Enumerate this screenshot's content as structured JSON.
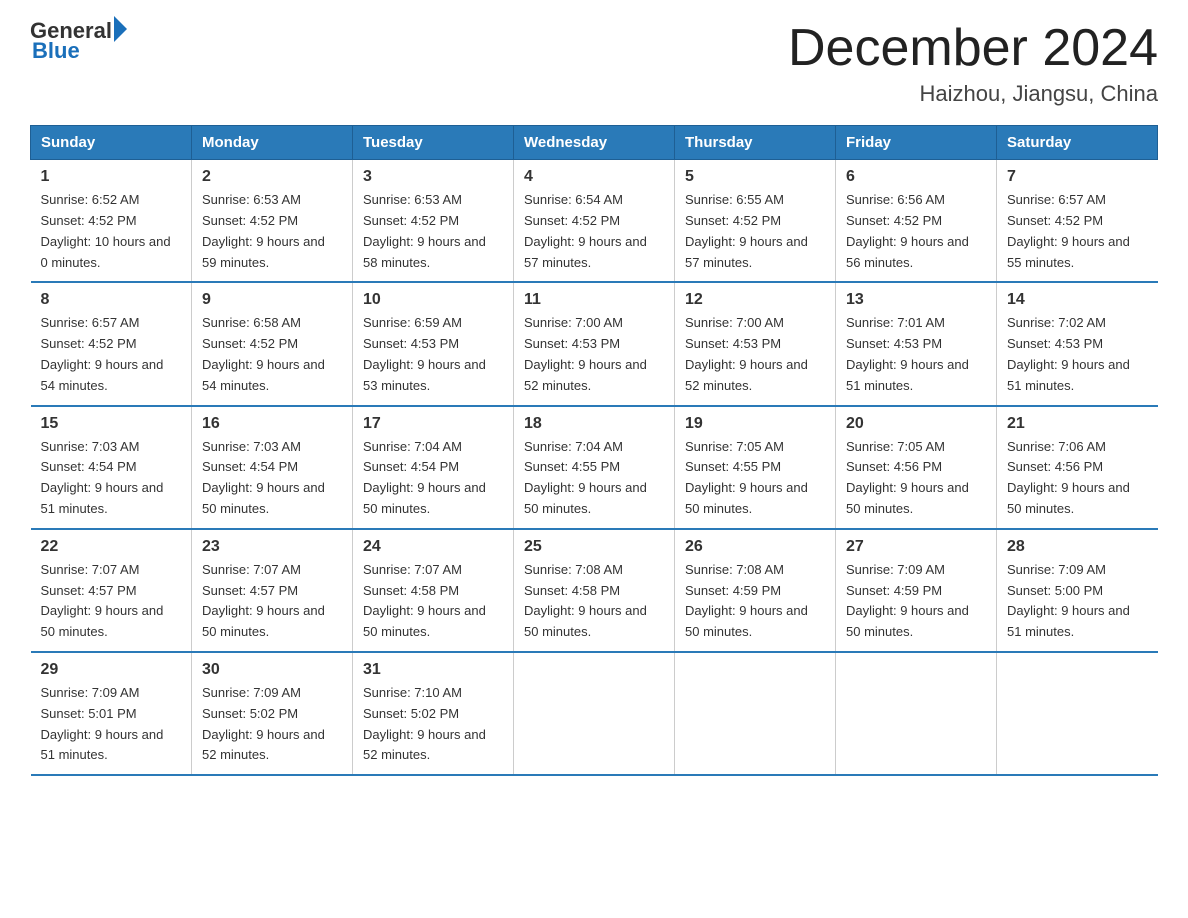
{
  "header": {
    "logo_general": "General",
    "logo_blue": "Blue",
    "month_title": "December 2024",
    "location": "Haizhou, Jiangsu, China"
  },
  "weekdays": [
    "Sunday",
    "Monday",
    "Tuesday",
    "Wednesday",
    "Thursday",
    "Friday",
    "Saturday"
  ],
  "weeks": [
    [
      {
        "day": "1",
        "sunrise": "6:52 AM",
        "sunset": "4:52 PM",
        "daylight": "10 hours and 0 minutes."
      },
      {
        "day": "2",
        "sunrise": "6:53 AM",
        "sunset": "4:52 PM",
        "daylight": "9 hours and 59 minutes."
      },
      {
        "day": "3",
        "sunrise": "6:53 AM",
        "sunset": "4:52 PM",
        "daylight": "9 hours and 58 minutes."
      },
      {
        "day": "4",
        "sunrise": "6:54 AM",
        "sunset": "4:52 PM",
        "daylight": "9 hours and 57 minutes."
      },
      {
        "day": "5",
        "sunrise": "6:55 AM",
        "sunset": "4:52 PM",
        "daylight": "9 hours and 57 minutes."
      },
      {
        "day": "6",
        "sunrise": "6:56 AM",
        "sunset": "4:52 PM",
        "daylight": "9 hours and 56 minutes."
      },
      {
        "day": "7",
        "sunrise": "6:57 AM",
        "sunset": "4:52 PM",
        "daylight": "9 hours and 55 minutes."
      }
    ],
    [
      {
        "day": "8",
        "sunrise": "6:57 AM",
        "sunset": "4:52 PM",
        "daylight": "9 hours and 54 minutes."
      },
      {
        "day": "9",
        "sunrise": "6:58 AM",
        "sunset": "4:52 PM",
        "daylight": "9 hours and 54 minutes."
      },
      {
        "day": "10",
        "sunrise": "6:59 AM",
        "sunset": "4:53 PM",
        "daylight": "9 hours and 53 minutes."
      },
      {
        "day": "11",
        "sunrise": "7:00 AM",
        "sunset": "4:53 PM",
        "daylight": "9 hours and 52 minutes."
      },
      {
        "day": "12",
        "sunrise": "7:00 AM",
        "sunset": "4:53 PM",
        "daylight": "9 hours and 52 minutes."
      },
      {
        "day": "13",
        "sunrise": "7:01 AM",
        "sunset": "4:53 PM",
        "daylight": "9 hours and 51 minutes."
      },
      {
        "day": "14",
        "sunrise": "7:02 AM",
        "sunset": "4:53 PM",
        "daylight": "9 hours and 51 minutes."
      }
    ],
    [
      {
        "day": "15",
        "sunrise": "7:03 AM",
        "sunset": "4:54 PM",
        "daylight": "9 hours and 51 minutes."
      },
      {
        "day": "16",
        "sunrise": "7:03 AM",
        "sunset": "4:54 PM",
        "daylight": "9 hours and 50 minutes."
      },
      {
        "day": "17",
        "sunrise": "7:04 AM",
        "sunset": "4:54 PM",
        "daylight": "9 hours and 50 minutes."
      },
      {
        "day": "18",
        "sunrise": "7:04 AM",
        "sunset": "4:55 PM",
        "daylight": "9 hours and 50 minutes."
      },
      {
        "day": "19",
        "sunrise": "7:05 AM",
        "sunset": "4:55 PM",
        "daylight": "9 hours and 50 minutes."
      },
      {
        "day": "20",
        "sunrise": "7:05 AM",
        "sunset": "4:56 PM",
        "daylight": "9 hours and 50 minutes."
      },
      {
        "day": "21",
        "sunrise": "7:06 AM",
        "sunset": "4:56 PM",
        "daylight": "9 hours and 50 minutes."
      }
    ],
    [
      {
        "day": "22",
        "sunrise": "7:07 AM",
        "sunset": "4:57 PM",
        "daylight": "9 hours and 50 minutes."
      },
      {
        "day": "23",
        "sunrise": "7:07 AM",
        "sunset": "4:57 PM",
        "daylight": "9 hours and 50 minutes."
      },
      {
        "day": "24",
        "sunrise": "7:07 AM",
        "sunset": "4:58 PM",
        "daylight": "9 hours and 50 minutes."
      },
      {
        "day": "25",
        "sunrise": "7:08 AM",
        "sunset": "4:58 PM",
        "daylight": "9 hours and 50 minutes."
      },
      {
        "day": "26",
        "sunrise": "7:08 AM",
        "sunset": "4:59 PM",
        "daylight": "9 hours and 50 minutes."
      },
      {
        "day": "27",
        "sunrise": "7:09 AM",
        "sunset": "4:59 PM",
        "daylight": "9 hours and 50 minutes."
      },
      {
        "day": "28",
        "sunrise": "7:09 AM",
        "sunset": "5:00 PM",
        "daylight": "9 hours and 51 minutes."
      }
    ],
    [
      {
        "day": "29",
        "sunrise": "7:09 AM",
        "sunset": "5:01 PM",
        "daylight": "9 hours and 51 minutes."
      },
      {
        "day": "30",
        "sunrise": "7:09 AM",
        "sunset": "5:02 PM",
        "daylight": "9 hours and 52 minutes."
      },
      {
        "day": "31",
        "sunrise": "7:10 AM",
        "sunset": "5:02 PM",
        "daylight": "9 hours and 52 minutes."
      },
      null,
      null,
      null,
      null
    ]
  ]
}
